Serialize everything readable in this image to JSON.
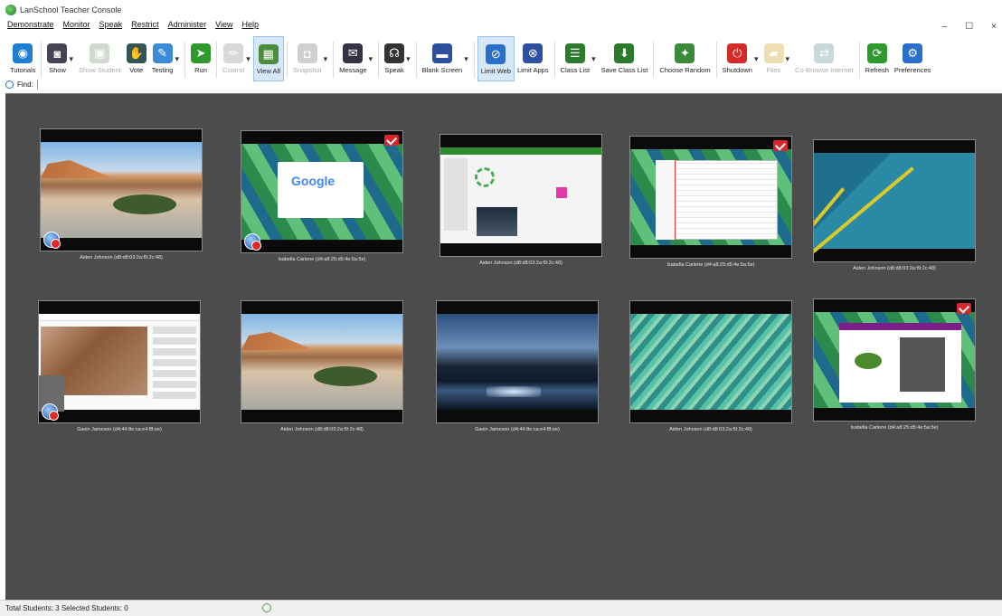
{
  "window": {
    "title": "LanSchool Teacher Console"
  },
  "menu": [
    "Demonstrate",
    "Monitor",
    "Speak",
    "Restrict",
    "Administer",
    "View",
    "Help"
  ],
  "toolbar": [
    {
      "id": "tutorials",
      "label": "Tutorials",
      "icon": "globe-icon",
      "color": "#1e7fd1",
      "dropdown": false,
      "active": false,
      "disabled": false
    },
    {
      "id": "show",
      "label": "Show",
      "icon": "presenter-icon",
      "color": "#445",
      "dropdown": true,
      "active": false,
      "disabled": false
    },
    {
      "id": "show-student",
      "label": "Show Student",
      "icon": "student-screen-icon",
      "color": "#9a9",
      "dropdown": false,
      "active": false,
      "disabled": true
    },
    {
      "id": "vote",
      "label": "Vote",
      "icon": "vote-icon",
      "color": "#355",
      "dropdown": false,
      "active": false,
      "disabled": false
    },
    {
      "id": "testing",
      "label": "Testing",
      "icon": "test-icon",
      "color": "#3b8bd6",
      "dropdown": true,
      "active": false,
      "disabled": false
    },
    {
      "id": "run",
      "label": "Run",
      "icon": "run-icon",
      "color": "#2e9a2e",
      "dropdown": false,
      "active": false,
      "disabled": false
    },
    {
      "id": "control",
      "label": "Control",
      "icon": "pencil-icon",
      "color": "#aaa",
      "dropdown": true,
      "active": false,
      "disabled": true
    },
    {
      "id": "view-all",
      "label": "View All",
      "icon": "grid-icon",
      "color": "#4c8c3c",
      "dropdown": false,
      "active": true,
      "disabled": false
    },
    {
      "id": "snapshot",
      "label": "Snapshot",
      "icon": "camera-icon",
      "color": "#999",
      "dropdown": true,
      "active": false,
      "disabled": true
    },
    {
      "id": "message",
      "label": "Message",
      "icon": "message-icon",
      "color": "#334",
      "dropdown": true,
      "active": false,
      "disabled": false
    },
    {
      "id": "speak",
      "label": "Speak",
      "icon": "headset-icon",
      "color": "#333",
      "dropdown": true,
      "active": false,
      "disabled": false
    },
    {
      "id": "blank-screen",
      "label": "Blank Screen",
      "icon": "blank-screen-icon",
      "color": "#2d4fa0",
      "dropdown": true,
      "active": false,
      "disabled": false
    },
    {
      "id": "limit-web",
      "label": "Limit Web",
      "icon": "limit-web-icon",
      "color": "#2a6fc9",
      "dropdown": false,
      "active": true,
      "disabled": false
    },
    {
      "id": "limit-apps",
      "label": "Limit Apps",
      "icon": "limit-apps-icon",
      "color": "#2d4fa0",
      "dropdown": false,
      "active": false,
      "disabled": false
    },
    {
      "id": "class-list",
      "label": "Class List",
      "icon": "class-list-icon",
      "color": "#2c7a2c",
      "dropdown": true,
      "active": false,
      "disabled": false
    },
    {
      "id": "save-class-list",
      "label": "Save Class List",
      "icon": "save-class-icon",
      "color": "#2c7a2c",
      "dropdown": false,
      "active": false,
      "disabled": false
    },
    {
      "id": "choose-random",
      "label": "Choose Random",
      "icon": "random-icon",
      "color": "#3a8a3a",
      "dropdown": false,
      "active": false,
      "disabled": false
    },
    {
      "id": "shutdown",
      "label": "Shutdown",
      "icon": "power-icon",
      "color": "#d32a2a",
      "dropdown": true,
      "active": false,
      "disabled": false
    },
    {
      "id": "files",
      "label": "Files",
      "icon": "folder-icon",
      "color": "#d8b85a",
      "dropdown": true,
      "active": false,
      "disabled": true
    },
    {
      "id": "co-browse",
      "label": "Co-Browse Internet",
      "icon": "co-browse-icon",
      "color": "#8aa",
      "dropdown": false,
      "active": false,
      "disabled": true
    },
    {
      "id": "refresh",
      "label": "Refresh",
      "icon": "refresh-icon",
      "color": "#2e9a2e",
      "dropdown": false,
      "active": false,
      "disabled": false
    },
    {
      "id": "preferences",
      "label": "Preferences",
      "icon": "preferences-icon",
      "color": "#2a6fc9",
      "dropdown": false,
      "active": false,
      "disabled": false
    }
  ],
  "find": {
    "label": "Find:"
  },
  "students": [
    {
      "name": "Aiden Johnson (d8:d8:03:2a:f9:2c:48)",
      "screen": "beach",
      "mail": false,
      "globe": true
    },
    {
      "name": "Isabella Carlene (d4:a8:25:d5:4e:5a:5e)",
      "screen": "google",
      "mail": true,
      "globe": true
    },
    {
      "name": "Aiden Johnson (d8:d8:03:2a:f9:2c:48)",
      "screen": "webapp",
      "mail": false,
      "globe": false
    },
    {
      "name": "Isabella Carlene (d4:a8:25:d5:4e:5a:5e)",
      "screen": "excel",
      "mail": true,
      "globe": false
    },
    {
      "name": "Aiden Johnson (d8:d8:03:2a:f9:2c:48)",
      "screen": "material",
      "mail": false,
      "globe": false
    },
    {
      "name": "Gavin Jameson (d4:44:8e:ca:e4:f8:ee)",
      "screen": "youtube",
      "mail": false,
      "globe": true
    },
    {
      "name": "Aiden Johnson (d8:d8:03:2a:f9:2c:48)",
      "screen": "beach",
      "mail": false,
      "globe": false
    },
    {
      "name": "Gavin Jameson (d4:44:8e:ca:e4:f8:ee)",
      "screen": "mountain",
      "mail": false,
      "globe": false
    },
    {
      "name": "Aiden Johnson (d8:d8:03:2a:f9:2c:48)",
      "screen": "aqua",
      "mail": false,
      "globe": false
    },
    {
      "name": "Isabella Carlene (d4:a8:25:d5:4e:5a:5e)",
      "screen": "frog",
      "mail": true,
      "globe": false
    }
  ],
  "status": {
    "text": "Total Students: 3 Selected Students: 0"
  }
}
